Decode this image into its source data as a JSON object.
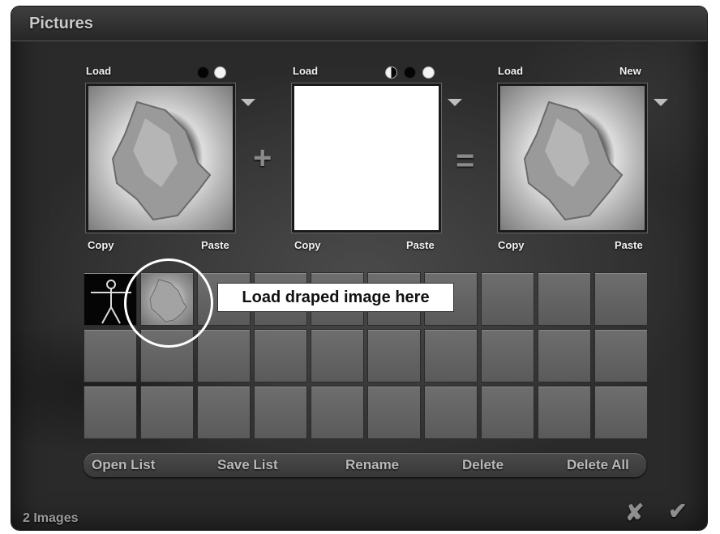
{
  "window": {
    "title": "Pictures"
  },
  "panels": [
    {
      "top_left": "Load",
      "top_right": "",
      "dots": [
        "black",
        "white"
      ],
      "copy": "Copy",
      "paste": "Paste"
    },
    {
      "top_left": "Load",
      "top_right": "",
      "dots": [
        "half",
        "black",
        "white"
      ],
      "copy": "Copy",
      "paste": "Paste"
    },
    {
      "top_left": "Load",
      "top_right": "New",
      "copy": "Copy",
      "paste": "Paste"
    }
  ],
  "operators": {
    "plus": "+",
    "equals": "="
  },
  "callout": {
    "text": "Load draped image here"
  },
  "buttons": {
    "open_list": "Open List",
    "save_list": "Save List",
    "rename": "Rename",
    "delete": "Delete",
    "delete_all": "Delete All"
  },
  "status": {
    "count": "2 Images"
  },
  "actions": {
    "cancel": "✘",
    "ok": "✔"
  }
}
